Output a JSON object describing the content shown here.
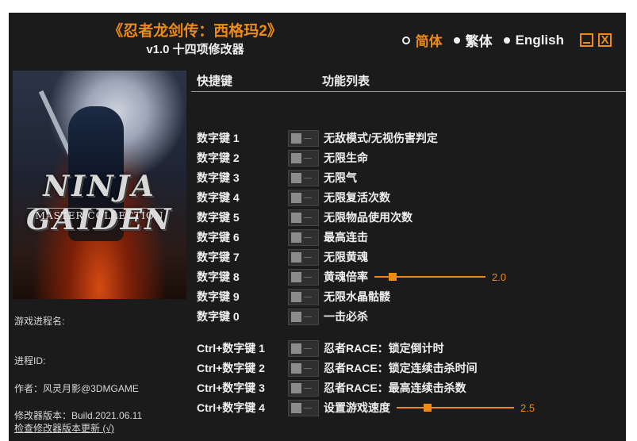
{
  "title": {
    "main": "《忍者龙剑传：西格玛2》",
    "sub": "v1.0 十四项修改器"
  },
  "languages": [
    {
      "label": "简体",
      "active": true
    },
    {
      "label": "繁体",
      "active": false
    },
    {
      "label": "English",
      "active": false
    }
  ],
  "window_buttons": {
    "close_glyph": "X"
  },
  "cover": {
    "logo": "NINJA GAIDEN",
    "collection": "MASTER COLLECTION"
  },
  "info": {
    "process_name": "游戏进程名:",
    "process_id": "进程ID:",
    "author": "作者：风灵月影@3DMGAME",
    "version": "修改器版本：Build.2021.06.11",
    "update_link": "检查修改器版本更新 (√)"
  },
  "headers": {
    "hotkey": "快捷键",
    "features": "功能列表"
  },
  "accent_color": "#f08a14",
  "cheats": [
    {
      "key": "数字键 1",
      "label": "无敌模式/无视伤害判定"
    },
    {
      "key": "数字键 2",
      "label": "无限生命"
    },
    {
      "key": "数字键 3",
      "label": "无限气"
    },
    {
      "key": "数字键 4",
      "label": "无限复活次数"
    },
    {
      "key": "数字键 5",
      "label": "无限物品使用次数"
    },
    {
      "key": "数字键 6",
      "label": "最高连击"
    },
    {
      "key": "数字键 7",
      "label": "无限黄魂"
    },
    {
      "key": "数字键 8",
      "label": "黄魂倍率",
      "slider_value": "2.0"
    },
    {
      "key": "数字键 9",
      "label": "无限水晶骷髅"
    },
    {
      "key": "数字键 0",
      "label": "一击必杀"
    },
    {
      "key": "Ctrl+数字键 1",
      "label": "忍者RACE：锁定倒计时"
    },
    {
      "key": "Ctrl+数字键 2",
      "label": "忍者RACE：锁定连续击杀时间"
    },
    {
      "key": "Ctrl+数字键 3",
      "label": "忍者RACE：最高连续击杀数"
    },
    {
      "key": "Ctrl+数字键 4",
      "label": "设置游戏速度",
      "slider_value": "2.5"
    }
  ]
}
